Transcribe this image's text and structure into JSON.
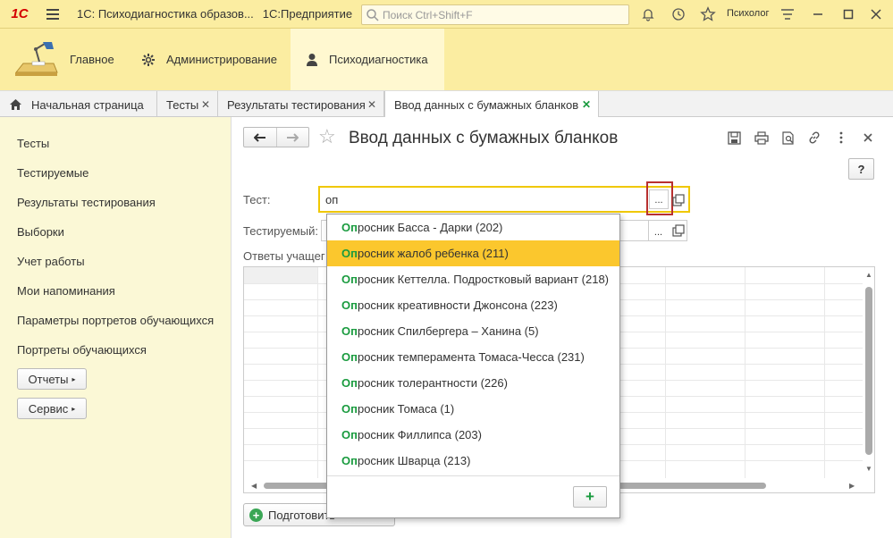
{
  "app": {
    "logo": "1С",
    "window_title": "1С: Психодиагностика образов...",
    "platform": "1С:Предприятие",
    "user": "Психолог"
  },
  "search": {
    "placeholder": "Поиск Ctrl+Shift+F"
  },
  "sections": [
    {
      "label": "Главное",
      "icon": "desk-lamp-icon"
    },
    {
      "label": "Администрирование",
      "icon": "gear-icon"
    },
    {
      "label": "Психодиагностика",
      "icon": "person-icon",
      "active": true
    }
  ],
  "tabs": [
    {
      "label": "Начальная страница",
      "icon": "home-icon"
    },
    {
      "label": "Тесты",
      "close": "✕"
    },
    {
      "label": "Результаты тестирования",
      "close": "✕"
    },
    {
      "label": "Ввод данных с бумажных бланков",
      "close": "✕",
      "active": true
    }
  ],
  "sidebar": {
    "items": [
      "Тесты",
      "Тестируемые",
      "Результаты тестирования",
      "Выборки",
      "Учет работы",
      "Мои напоминания",
      "Параметры портретов обучающихся",
      "Портреты обучающихся"
    ],
    "buttons": [
      {
        "label": "Отчеты",
        "arrow": "▸"
      },
      {
        "label": "Сервис",
        "arrow": "▸"
      }
    ]
  },
  "form": {
    "title": "Ввод данных с бумажных бланков",
    "help_label": "?",
    "test_label": "Тест:",
    "test_value": "оп",
    "choose_button": "...",
    "subject_label": "Тестируемый:",
    "answers_label": "Ответы учащег",
    "bottom_button": "Подготовить"
  },
  "dropdown": {
    "highlight_color": "#1a9b3f",
    "selected_color": "#fbc72d",
    "items": [
      {
        "prefix": "Оп",
        "rest": "росник Басса - Дарки (202)"
      },
      {
        "prefix": "Оп",
        "rest": "росник жалоб ребенка (211)",
        "selected": true
      },
      {
        "prefix": "Оп",
        "rest": "росник Кеттелла. Подростковый вариант (218)"
      },
      {
        "prefix": "Оп",
        "rest": "росник креативности Джонсона (223)"
      },
      {
        "prefix": "Оп",
        "rest": "росник Спилбергера – Ханина (5)"
      },
      {
        "prefix": "Оп",
        "rest": "росник темперамента Томаса-Чесса (231)"
      },
      {
        "prefix": "Оп",
        "rest": "росник толерантности (226)"
      },
      {
        "prefix": "Оп",
        "rest": "росник Томаса (1)"
      },
      {
        "prefix": "Оп",
        "rest": "росник Филлипса (203)"
      },
      {
        "prefix": "Оп",
        "rest": "росник Шварца (213)"
      }
    ],
    "add_label": "+"
  },
  "colors": {
    "titlebar": "#fbeda1",
    "sidebar": "#fbf8d6",
    "accent_green": "#1a9b3f",
    "focus_yellow": "#f0c800"
  }
}
